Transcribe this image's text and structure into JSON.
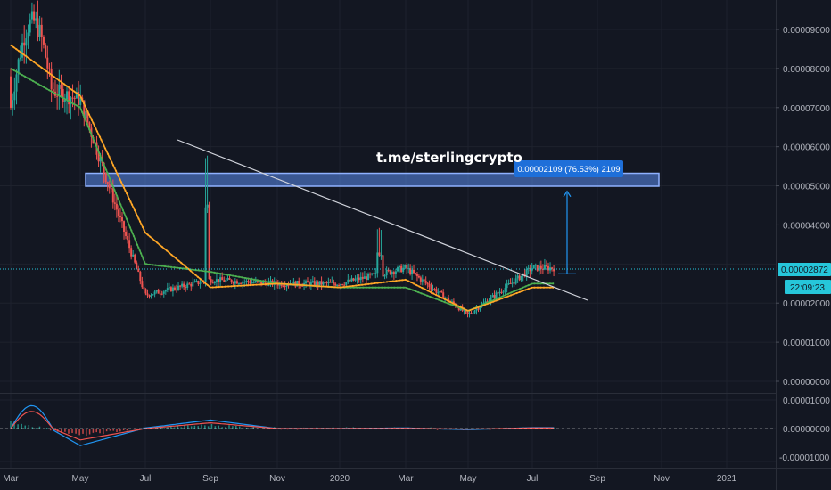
{
  "watermark": "t.me/sterlingcrypto",
  "measure_label": "0.00002109 (76.53%) 2109",
  "current_price_label": "0.00002872",
  "countdown_label": "22:09:23",
  "colors": {
    "background": "#131722",
    "grid": "#1e222d",
    "up_candle": "#26a69a",
    "down_candle": "#ef5350",
    "ma_fast": "#4caf50",
    "ma_slow": "#ffa726",
    "trendline": "#d1d4dc",
    "zone": "#5b8def",
    "badge": "#1e6fd9",
    "macd": "#2196f3",
    "signal": "#ef5350",
    "price_line": "#26c6da"
  },
  "chart_data": [
    {
      "type": "candlestick",
      "title": "",
      "y_ticks": [
        "0.00009000",
        "0.00008000",
        "0.00007000",
        "0.00006000",
        "0.00005000",
        "0.00004000",
        "0.00002000",
        "0.00001000",
        "0.00000000"
      ],
      "ylim": [
        0,
        0.0001
      ],
      "x_ticks": [
        "Mar",
        "May",
        "Jul",
        "Sep",
        "Nov",
        "2020",
        "Mar",
        "May",
        "Jul",
        "Sep",
        "Nov",
        "2021"
      ],
      "current_price": 2.872e-05,
      "resistance_zone": [
        4.99e-05,
        5.32e-05
      ],
      "series": [
        {
          "role": "close",
          "x": [
            "Mar",
            "May",
            "Jul",
            "Sep",
            "Nov",
            "2020",
            "Mar",
            "May",
            "Jul"
          ],
          "values": [
            7.8e-05,
            7.2e-05,
            2.2e-05,
            2.6e-05,
            2.5e-05,
            2.5e-05,
            2.9e-05,
            1.7e-05,
            2.9e-05
          ]
        },
        {
          "role": "ma_fast",
          "x": [
            "Mar",
            "May",
            "Jul",
            "Sep",
            "Nov",
            "2020",
            "Mar",
            "May",
            "Jul"
          ],
          "values": [
            8e-05,
            7e-05,
            3e-05,
            2.8e-05,
            2.5e-05,
            2.4e-05,
            2.4e-05,
            1.8e-05,
            2.5e-05
          ]
        },
        {
          "role": "ma_slow",
          "x": [
            "Mar",
            "May",
            "Jul",
            "Sep",
            "Nov",
            "2020",
            "Mar",
            "May",
            "Jul"
          ],
          "values": [
            8.6e-05,
            7.3e-05,
            3.8e-05,
            2.4e-05,
            2.5e-05,
            2.4e-05,
            2.6e-05,
            1.8e-05,
            2.4e-05
          ]
        }
      ],
      "measure": {
        "from": 2.75e-05,
        "to": 4.859e-05,
        "change": 2.109e-05,
        "percent": 76.53,
        "bars": 2109
      }
    },
    {
      "type": "line",
      "title": "",
      "y_ticks": [
        "0.00001000",
        "0.00000000",
        "-0.00001000"
      ],
      "ylim": [
        -1e-05,
        1e-05
      ],
      "series": [
        {
          "role": "macd",
          "x": [
            "Mar",
            "May",
            "Jul",
            "Sep",
            "Nov",
            "2020",
            "Mar",
            "May",
            "Jul"
          ],
          "values": [
            8e-06,
            -6e-06,
            2e-07,
            3e-06,
            0.0,
            0.0,
            2e-07,
            -4e-07,
            3e-07
          ]
        },
        {
          "role": "signal",
          "x": [
            "Mar",
            "May",
            "Jul",
            "Sep",
            "Nov",
            "2020",
            "Mar",
            "May",
            "Jul"
          ],
          "values": [
            6e-06,
            -4e-06,
            0.0,
            2e-06,
            0.0,
            0.0,
            1e-07,
            -2e-07,
            2e-07
          ]
        }
      ]
    }
  ]
}
